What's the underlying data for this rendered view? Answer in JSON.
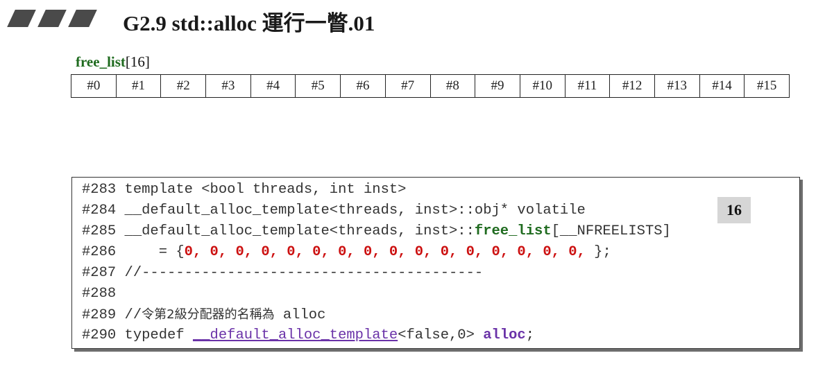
{
  "header": {
    "title": "G2.9 std::alloc 運行一瞥.01"
  },
  "free_list": {
    "name": "free_list",
    "size": "[16]",
    "cells": [
      "#0",
      "#1",
      "#2",
      "#3",
      "#4",
      "#5",
      "#6",
      "#7",
      "#8",
      "#9",
      "#10",
      "#11",
      "#12",
      "#13",
      "#14",
      "#15"
    ]
  },
  "code": {
    "badge": "16",
    "lines": {
      "l283": {
        "num": "#283",
        "text": " template <bool threads, int inst>"
      },
      "l284": {
        "num": "#284",
        "text": " __default_alloc_template<threads, inst>::obj* volatile"
      },
      "l285": {
        "num": "#285",
        "pre": " __default_alloc_template<threads, inst>::",
        "kw": "free_list",
        "post": "[__NFREELISTS]"
      },
      "l286": {
        "num": "#286",
        "pre": "     = {",
        "zeros": "0, 0, 0, 0, 0, 0, 0, 0, 0, 0, 0, 0, 0, 0, 0, 0,",
        "post": " };"
      },
      "l287": {
        "num": "#287",
        "text": " //----------------------------------------"
      },
      "l288": {
        "num": "#288",
        "text": ""
      },
      "l289": {
        "num": "#289",
        "pre": " //",
        "cjk": "令第2級分配器的名稱為",
        "post": " alloc"
      },
      "l290": {
        "num": "#290",
        "pre": " typedef ",
        "tmpl": "__default_alloc_template",
        "mid": "<false,0> ",
        "kw": "alloc",
        "post": ";"
      }
    }
  }
}
